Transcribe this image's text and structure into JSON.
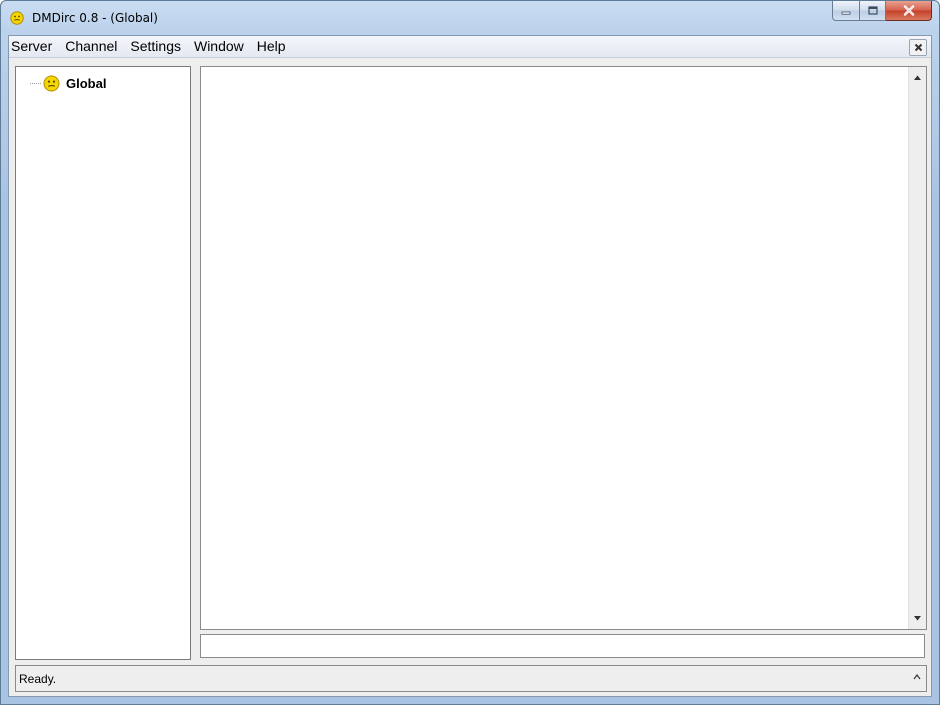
{
  "window": {
    "title": "DMDirc 0.8 - (Global)",
    "title_icon": "smiley-icon",
    "controls": [
      "minimize-icon",
      "maximize-icon",
      "close-icon"
    ]
  },
  "menubar": {
    "items": [
      {
        "label": "Server"
      },
      {
        "label": "Channel"
      },
      {
        "label": "Settings"
      },
      {
        "label": "Window"
      },
      {
        "label": "Help"
      }
    ],
    "close_icon": "close-icon"
  },
  "tree": {
    "items": [
      {
        "label": "Global",
        "icon": "smiley-icon"
      }
    ]
  },
  "text_pane": {
    "scroll_up_icon": "scroll-up-arrow-icon",
    "scroll_down_icon": "scroll-down-arrow-icon"
  },
  "input": {
    "value": "",
    "placeholder": ""
  },
  "status": {
    "text": "Ready.",
    "toggle_icon": "chevron-up-icon"
  },
  "colors": {
    "title_gradient_top": "#c9dcf1",
    "title_gradient_bottom": "#a9c4e3",
    "close_button": "#c4402a",
    "smiley_fill": "#f4d600",
    "frame_bg": "#eeeeee"
  }
}
